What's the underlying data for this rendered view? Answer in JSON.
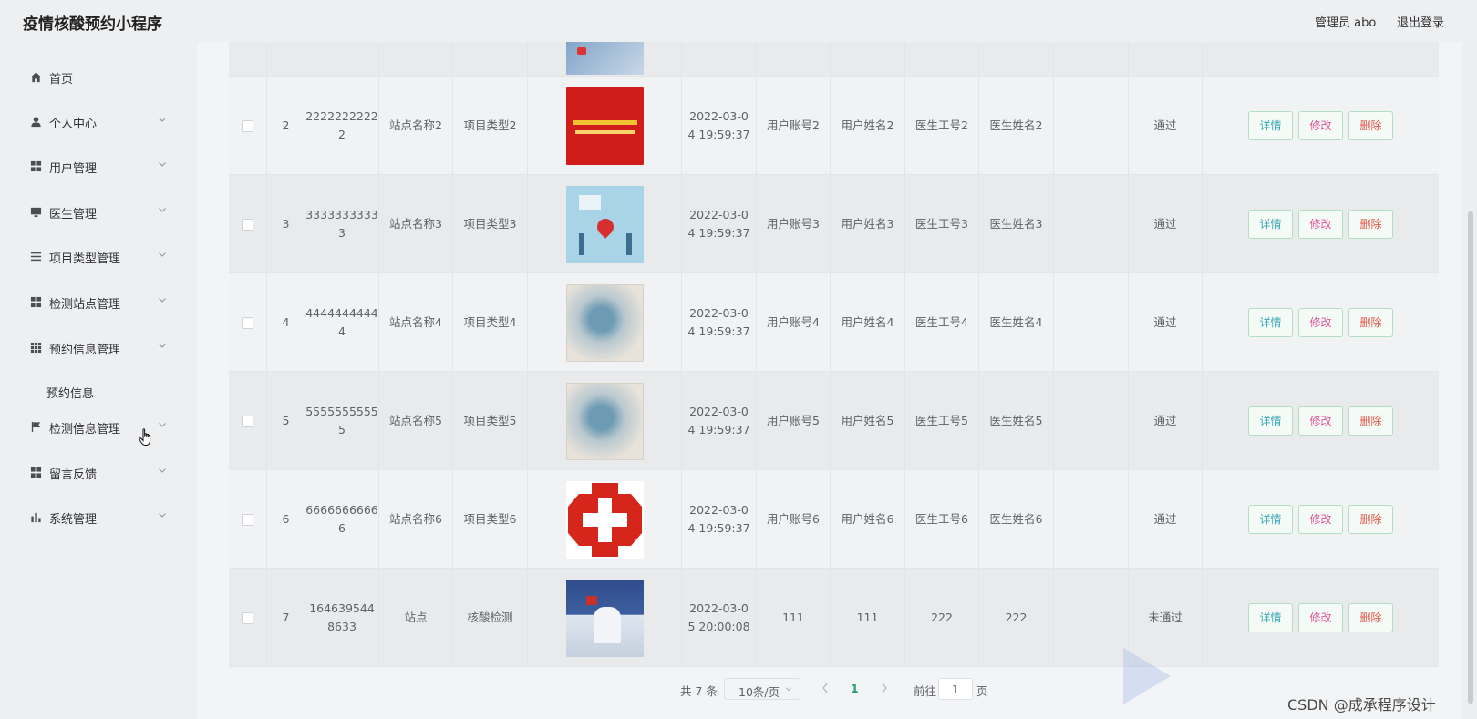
{
  "header": {
    "app_title": "疫情核酸预约小程序",
    "user": "管理员 abo",
    "logout": "退出登录"
  },
  "sidebar": {
    "items": [
      {
        "label": "首页",
        "icon": "home-icon"
      },
      {
        "label": "个人中心",
        "icon": "user-icon"
      },
      {
        "label": "用户管理",
        "icon": "grid-icon"
      },
      {
        "label": "医生管理",
        "icon": "monitor-icon"
      },
      {
        "label": "项目类型管理",
        "icon": "list-icon"
      },
      {
        "label": "检测站点管理",
        "icon": "grid-icon"
      },
      {
        "label": "预约信息管理",
        "icon": "apps-icon"
      },
      {
        "label": "检测信息管理",
        "icon": "flag-icon"
      },
      {
        "label": "留言反馈",
        "icon": "grid-icon"
      },
      {
        "label": "系统管理",
        "icon": "chart-icon"
      }
    ],
    "subitem": "预约信息"
  },
  "buttons": {
    "detail": "详情",
    "edit": "修改",
    "delete": "删除"
  },
  "rows": [
    {
      "index": "2",
      "phone": "2222222222",
      "phone_tail": "2",
      "station": "站点名称2",
      "project": "项目类型2",
      "date_a": "2022-03-0",
      "date_b": "4 19:59:37",
      "account": "用户账号2",
      "username": "用户姓名2",
      "doc_id": "医生工号2",
      "doc_name": "医生姓名2",
      "status": "通过"
    },
    {
      "index": "3",
      "phone": "3333333333",
      "phone_tail": "3",
      "station": "站点名称3",
      "project": "项目类型3",
      "date_a": "2022-03-0",
      "date_b": "4 19:59:37",
      "account": "用户账号3",
      "username": "用户姓名3",
      "doc_id": "医生工号3",
      "doc_name": "医生姓名3",
      "status": "通过"
    },
    {
      "index": "4",
      "phone": "4444444444",
      "phone_tail": "4",
      "station": "站点名称4",
      "project": "项目类型4",
      "date_a": "2022-03-0",
      "date_b": "4 19:59:37",
      "account": "用户账号4",
      "username": "用户姓名4",
      "doc_id": "医生工号4",
      "doc_name": "医生姓名4",
      "status": "通过"
    },
    {
      "index": "5",
      "phone": "5555555555",
      "phone_tail": "5",
      "station": "站点名称5",
      "project": "项目类型5",
      "date_a": "2022-03-0",
      "date_b": "4 19:59:37",
      "account": "用户账号5",
      "username": "用户姓名5",
      "doc_id": "医生工号5",
      "doc_name": "医生姓名5",
      "status": "通过"
    },
    {
      "index": "6",
      "phone": "6666666666",
      "phone_tail": "6",
      "station": "站点名称6",
      "project": "项目类型6",
      "date_a": "2022-03-0",
      "date_b": "4 19:59:37",
      "account": "用户账号6",
      "username": "用户姓名6",
      "doc_id": "医生工号6",
      "doc_name": "医生姓名6",
      "status": "通过"
    },
    {
      "index": "7",
      "phone": "164639544",
      "phone_tail": "8633",
      "station": "站点",
      "project": "核酸检测",
      "date_a": "2022-03-0",
      "date_b": "5 20:00:08",
      "account": "111",
      "username": "111",
      "doc_id": "222",
      "doc_name": "222",
      "status": "未通过"
    }
  ],
  "pager": {
    "total": "共 7 条",
    "page_size": "10条/页",
    "current": "1",
    "goto": "前往",
    "goto_value": "1",
    "page_unit": "页"
  },
  "watermark": "CSDN @成承程序设计"
}
